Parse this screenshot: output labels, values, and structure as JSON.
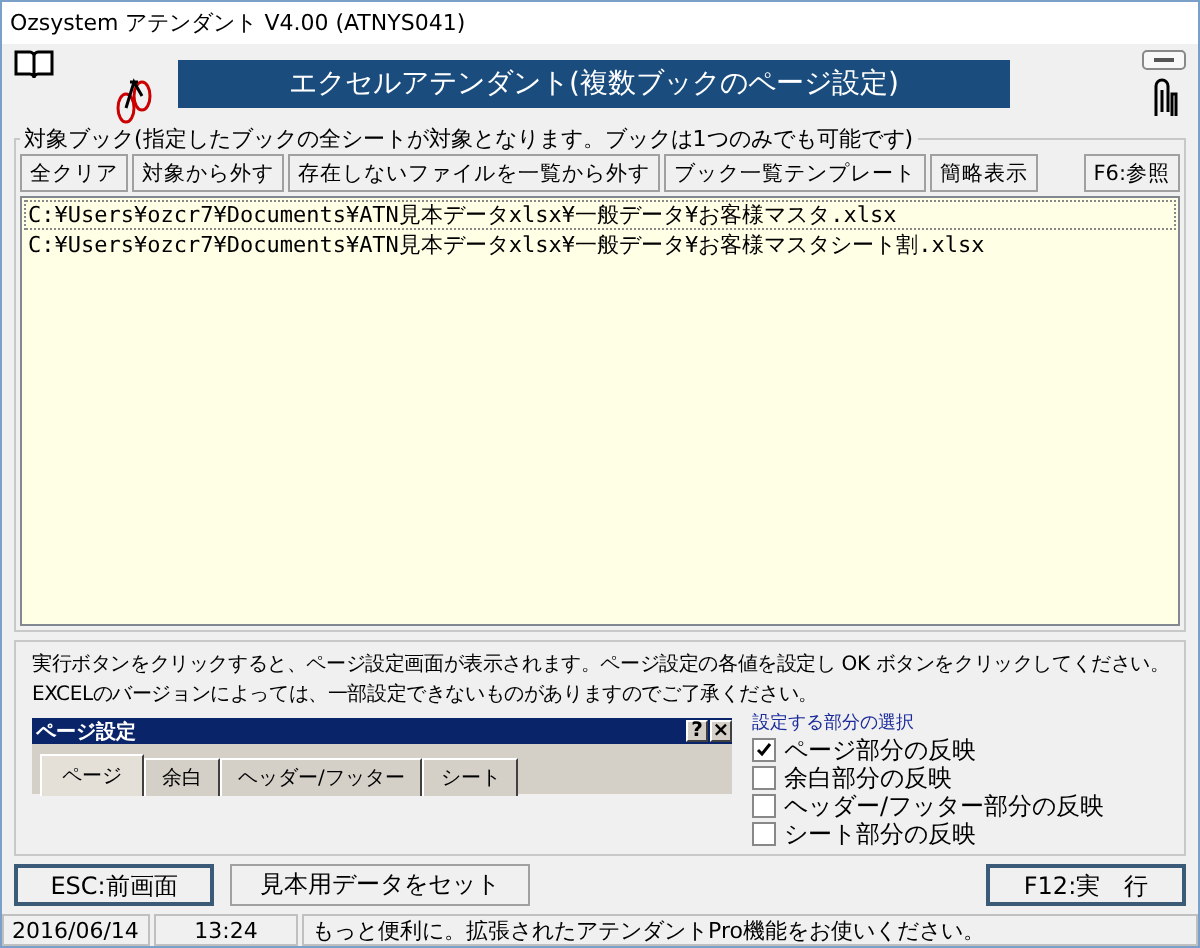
{
  "window": {
    "title": "Ozsystem アテンダント V4.00 (ATNYS041)"
  },
  "banner": "エクセルアテンダント(複数ブックのページ設定)",
  "target_group": {
    "legend": "対象ブック(指定したブックの全シートが対象となります。ブックは1つのみでも可能です)",
    "toolbar": [
      "全クリア",
      "対象から外す",
      "存在しないファイルを一覧から外す",
      "ブック一覧テンプレート",
      "簡略表示"
    ],
    "browse_button": "F6:参照",
    "files": [
      {
        "path": "C:¥Users¥ozcr7¥Documents¥ATN見本データxlsx¥一般データ¥お客様マスタ.xlsx",
        "selected": true
      },
      {
        "path": "C:¥Users¥ozcr7¥Documents¥ATN見本データxlsx¥一般データ¥お客様マスタシート割.xlsx",
        "selected": false
      }
    ]
  },
  "info": {
    "lines": [
      "実行ボタンをクリックすると、ページ設定画面が表示されます。ページ設定の各値を設定し OK ボタンをクリックしてください。",
      "EXCELのバージョンによっては、一部設定できないものがありますのでご了承ください。"
    ],
    "dialog_preview": {
      "title": "ページ設定",
      "help": "?",
      "close": "×",
      "tabs": [
        {
          "label": "ページ",
          "selected": true
        },
        {
          "label": "余白",
          "selected": false
        },
        {
          "label": "ヘッダー/フッター",
          "selected": false
        },
        {
          "label": "シート",
          "selected": false
        }
      ]
    },
    "options": {
      "title": "設定する部分の選択",
      "items": [
        {
          "label": "ページ部分の反映",
          "checked": true
        },
        {
          "label": "余白部分の反映",
          "checked": false
        },
        {
          "label": "ヘッダー/フッター部分の反映",
          "checked": false
        },
        {
          "label": "シート部分の反映",
          "checked": false
        }
      ]
    }
  },
  "buttons": {
    "back": "ESC:前画面",
    "sample": "見本用データをセット",
    "run": "F12:実　行"
  },
  "status_bar": {
    "date": "2016/06/14",
    "time": "13:24",
    "message": "もっと便利に。拡張されたアテンダントPro機能をお使いください。"
  }
}
